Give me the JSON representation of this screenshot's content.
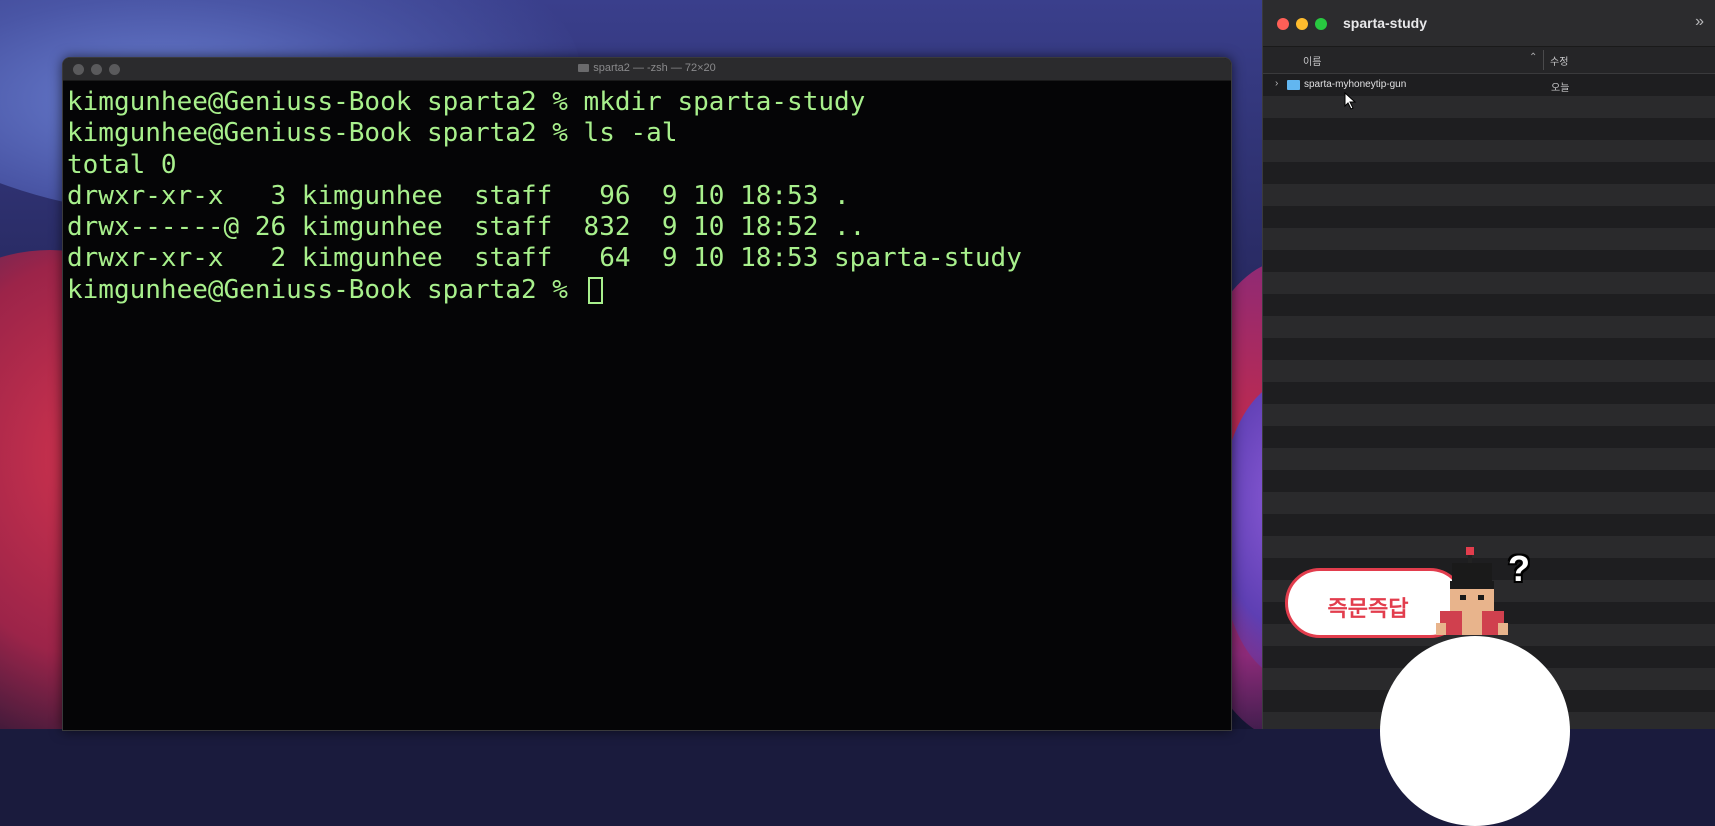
{
  "terminal": {
    "title": "sparta2 — -zsh — 72×20",
    "lines": [
      "kimgunhee@Geniuss-Book sparta2 % mkdir sparta-study",
      "kimgunhee@Geniuss-Book sparta2 % ls -al",
      "total 0",
      "drwxr-xr-x   3 kimgunhee  staff   96  9 10 18:53 .",
      "drwx------@ 26 kimgunhee  staff  832  9 10 18:52 ..",
      "drwxr-xr-x   2 kimgunhee  staff   64  9 10 18:53 sparta-study",
      "kimgunhee@Geniuss-Book sparta2 % "
    ],
    "text_color": "#a8f08c"
  },
  "finder": {
    "title": "sparta-study",
    "more_icon": "chevron-double-right",
    "columns": {
      "name": "이름",
      "modified": "수정"
    },
    "rows": [
      {
        "name": "sparta-myhoneytip-gun",
        "date": "오늘"
      }
    ],
    "folder_color": "#62b6f0"
  },
  "overlay": {
    "badge_label": "즉문즉답",
    "question_mark": "?",
    "accent": "#e23d4d"
  }
}
